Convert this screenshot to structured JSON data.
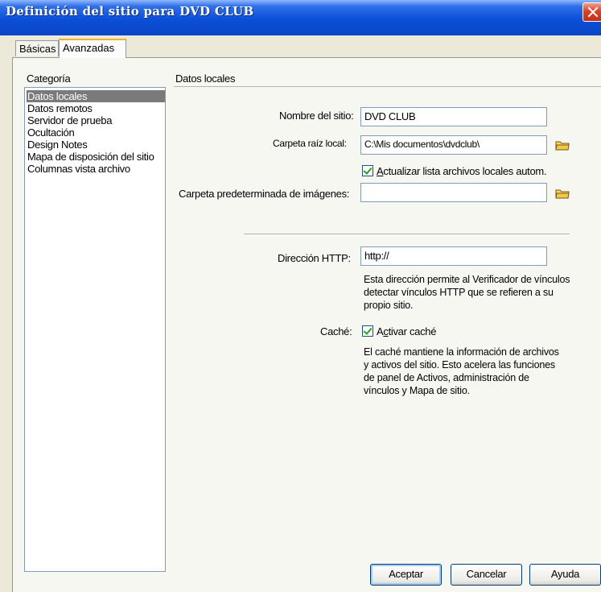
{
  "window": {
    "title": "Definición del sitio para DVD CLUB"
  },
  "tabs": [
    {
      "label": "Básicas"
    },
    {
      "label": "Avanzadas"
    }
  ],
  "category": {
    "heading": "Categoría",
    "items": [
      {
        "label": "Datos locales"
      },
      {
        "label": "Datos remotos"
      },
      {
        "label": "Servidor de prueba"
      },
      {
        "label": "Ocultación"
      },
      {
        "label": "Design Notes"
      },
      {
        "label": "Mapa de disposición del sitio"
      },
      {
        "label": "Columnas vista archivo"
      }
    ]
  },
  "section": {
    "title": "Datos locales"
  },
  "form": {
    "site_name_label": "Nombre del sitio:",
    "site_name_value": "DVD CLUB",
    "root_folder_label": "Carpeta raíz local:",
    "root_folder_value": "C:\\Mis documentos\\dvdclub\\",
    "auto_refresh_label_pre": "",
    "auto_refresh_label_key": "A",
    "auto_refresh_label_post": "ctualizar lista archivos locales autom.",
    "images_folder_label": "Carpeta predeterminada de imágenes:",
    "images_folder_value": "",
    "http_label": "Dirección HTTP:",
    "http_value": "http://",
    "http_help": "Esta dirección permite al Verificador de vínculos detectar vínculos HTTP que se refieren a su propio sitio.",
    "cache_label": "Caché:",
    "cache_check_pre": "A",
    "cache_check_key": "c",
    "cache_check_post": "tivar caché",
    "cache_help": "El caché mantiene la información de archivos y activos del sitio. Esto acelera las funciones de panel de Activos, administración de vínculos y Mapa de sitio."
  },
  "buttons": {
    "accept": "Aceptar",
    "cancel": "Cancelar",
    "help": "Ayuda"
  },
  "colors": {
    "title_bar": "#0b4fd8",
    "close": "#d9432a",
    "selected": "#7a7a7a",
    "check": "#21a121"
  }
}
